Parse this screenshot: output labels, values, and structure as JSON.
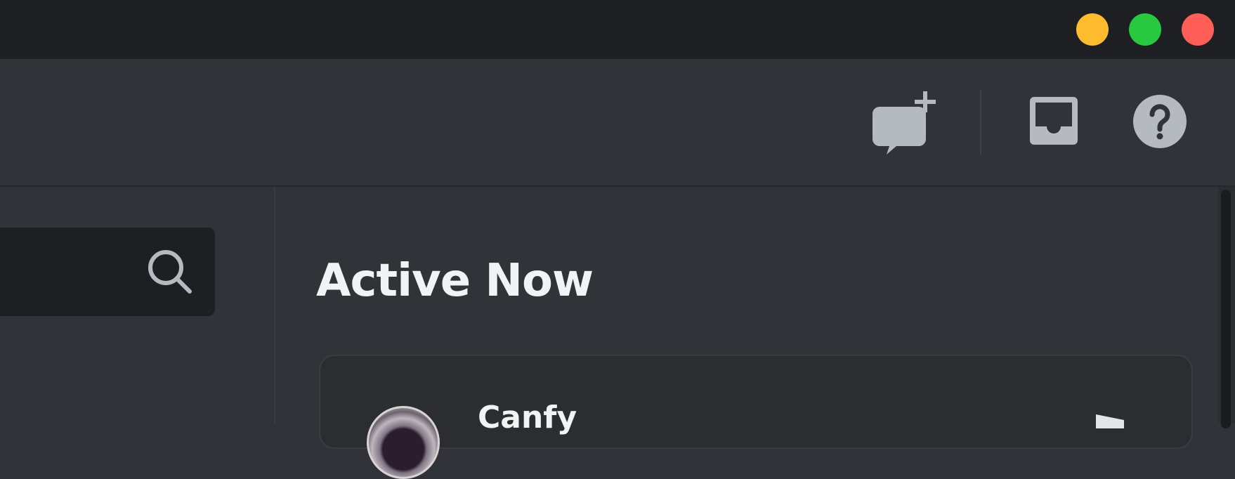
{
  "window": {
    "controls": {
      "minimize_color": "#febc2e",
      "maximize_color": "#28c840",
      "close_color": "#ff5f57"
    }
  },
  "toolbar": {
    "icons": [
      "new-group-dm-icon",
      "inbox-icon",
      "help-icon"
    ]
  },
  "search": {
    "icon": "search-icon"
  },
  "active_now": {
    "title": "Active Now",
    "cards": [
      {
        "name": "Canfy",
        "avatar": "avatar"
      }
    ]
  },
  "colors": {
    "titlebar": "#1e1f22",
    "background": "#313338",
    "search_bg": "#1e1f22",
    "card_bg": "#2b2d31",
    "icon": "#b5bac1",
    "heading": "#f2f3f5"
  }
}
